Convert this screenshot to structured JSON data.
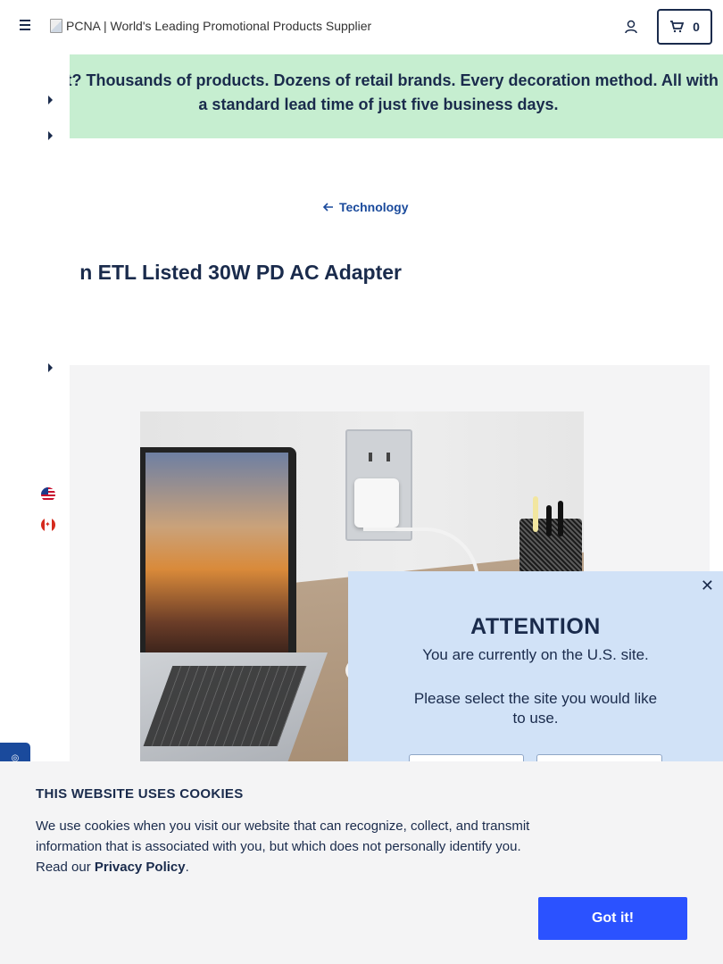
{
  "header": {
    "logo_alt": "PCNA | World's Leading Promotional Products Supplier",
    "cart_count": "0"
  },
  "promo": {
    "text": "Wait? Thousands of products. Dozens of retail brands. Every decoration method. All with a standard lead time of just five business days."
  },
  "breadcrumb": {
    "back_label": "Technology"
  },
  "product": {
    "title": "n ETL Listed 30W PD AC Adapter"
  },
  "attention": {
    "heading": "ATTENTION",
    "current_site": "You are currently on the U.S. site.",
    "prompt": "Please select the site you would like to use."
  },
  "cookie": {
    "heading": "THIS WEBSITE USES COOKIES",
    "body_before": "We use cookies when you visit our website that can recognize, collect, and transmit information that is associated with you, but which does not personally identify you. Read our ",
    "privacy_link": "Privacy Policy",
    "body_after": ".",
    "accept_label": "Got it!"
  },
  "colors": {
    "navy": "#1a2b4c",
    "promo_green": "#c6eed0",
    "modal_blue": "#d1e2f7",
    "button_blue": "#2b52ff"
  }
}
